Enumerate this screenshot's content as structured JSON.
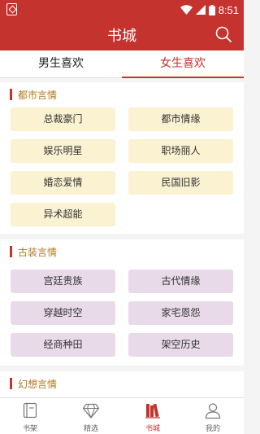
{
  "status": {
    "time": "8:51"
  },
  "header": {
    "title": "书城"
  },
  "tabs": [
    {
      "label": "男生喜欢"
    },
    {
      "label": "女生喜欢"
    }
  ],
  "sections": [
    {
      "title": "都市言情",
      "items": [
        "总裁豪门",
        "都市情缘",
        "娱乐明星",
        "职场丽人",
        "婚恋爱情",
        "民国旧影",
        "异术超能"
      ]
    },
    {
      "title": "古装言情",
      "items": [
        "宫廷贵族",
        "古代情缘",
        "穿越时空",
        "家宅恩怨",
        "经商种田",
        "架空历史"
      ]
    },
    {
      "title": "幻想言情"
    }
  ],
  "bottom_nav": [
    {
      "label": "书架",
      "icon": "bookshelf-icon"
    },
    {
      "label": "精选",
      "icon": "diamond-icon"
    },
    {
      "label": "书城",
      "icon": "books-icon"
    },
    {
      "label": "我的",
      "icon": "user-icon"
    }
  ],
  "colors": {
    "primary": "#c5332e",
    "section_title": "#b07a1c",
    "chip_yellow": "#faf2d1",
    "chip_purple": "#e9dae9"
  }
}
